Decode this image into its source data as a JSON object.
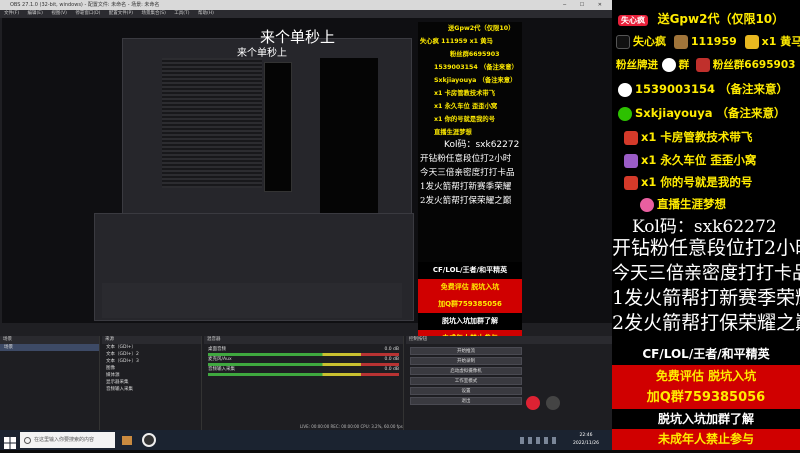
{
  "window": {
    "title": "OBS 27.1.0 (32-bit, windows) - 配置文件: 未命名 - 场景: 未命名",
    "menu": [
      "文件(F)",
      "编辑(E)",
      "视图(V)",
      "停靠窗口(D)",
      "配置文件(P)",
      "场景集合(S)",
      "工具(T)",
      "帮助(H)"
    ]
  },
  "preview": {
    "floating_text": "来个单秒上",
    "floating_text_2": "来个单秒上"
  },
  "overlay": {
    "badge": "失心疯",
    "line1": "送Gpw2代（仅限10）",
    "line2a": "失心疯",
    "line2b": "111959",
    "line2c": "x1 黄马",
    "line3a": "粉丝牌进",
    "line3b": "群",
    "line3c": "粉丝群6695903",
    "line4": "1539003154 （备注来意）",
    "line5": "Sxkjiayouya （备注来意）",
    "line6": "x1 卡房管教技术带飞",
    "line7": "x1 永久车位 歪歪小窝",
    "line8": "x1 你的号就是我的号",
    "line9": "直播生涯梦想",
    "line10": "Kol码：sxk62272",
    "big1": "开钻粉任意段位打2小时",
    "big2": "今天三倍亲密度打打卡品",
    "big3": "1发火箭帮打新赛季荣耀",
    "big4": "2发火箭帮打保荣耀之巅",
    "band1": "CF/LOL/王者/和平精英",
    "band2": "免费评估 脱坑入坑",
    "band3": "加Q群759385056",
    "band4": "脱坑入坑加群了解",
    "band5": "未成年人禁止参与"
  },
  "docks": {
    "scenes_header": "场景",
    "scenes": [
      "场景"
    ],
    "sources_header": "来源",
    "sources": [
      "文本（GDI+）",
      "文本（GDI+）2",
      "文本（GDI+）3",
      "图像",
      "媒体源",
      "显示器采集",
      "音频输入采集"
    ],
    "mixer_header": "混音器",
    "mixer": [
      {
        "name": "桌面音频",
        "db": "0.0 dB"
      },
      {
        "name": "麦克风/Aux",
        "db": "0.0 dB"
      },
      {
        "name": "音频输入采集",
        "db": "0.0 dB"
      }
    ],
    "controls_header": "控制按钮",
    "controls": [
      "开始推流",
      "开始录制",
      "启动虚拟摄像机",
      "工作室模式",
      "设置",
      "退出"
    ],
    "status": "LIVE: 00:00:00  REC: 00:00:00  CPU: 3.2%, 60.00 fps"
  },
  "taskbar": {
    "search_placeholder": "在这里输入你要搜索的内容",
    "time": "22:46",
    "date": "2022/11/26"
  }
}
